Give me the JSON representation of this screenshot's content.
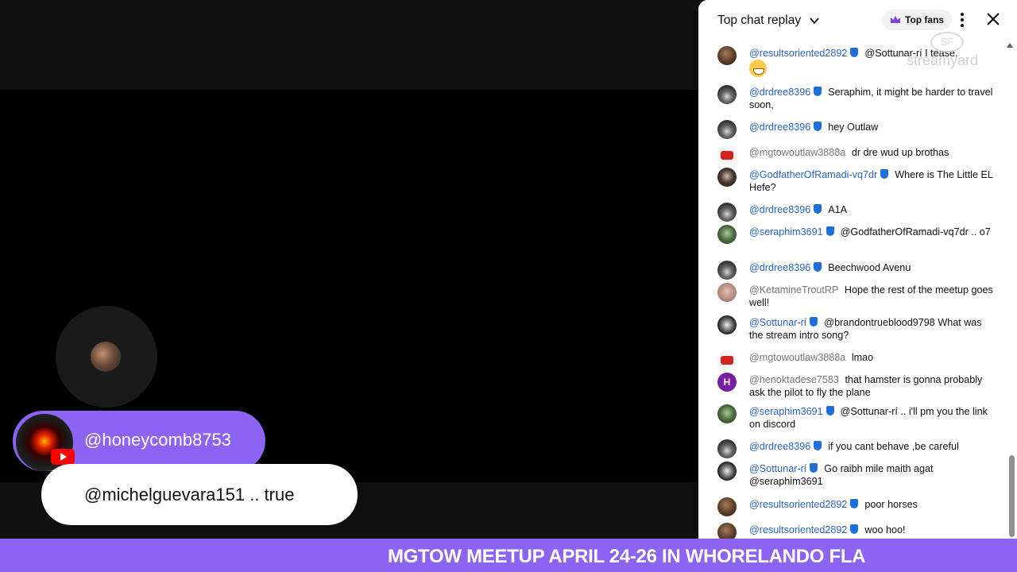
{
  "stream": {
    "guest_name": "@honeycomb8753",
    "guest_message": "@michelguevara151 .. true",
    "banner": "MGTOW MEETUP APRIL 24-26 IN WHORELANDO FLA"
  },
  "chat": {
    "title": "Top chat replay",
    "top_fans_label": "Top fans",
    "watermark": "streamyard",
    "messages": [
      {
        "author": "@resultsoriented2892",
        "text": "@Sottunar-rí I tease.",
        "mod": true,
        "avatar": "brown",
        "emoji": "grin"
      },
      {
        "author": "@drdree8396",
        "text": "Seraphim, it might be harder to travel soon,",
        "mod": true,
        "avatar": "car"
      },
      {
        "author": "@drdree8396",
        "text": "hey Outlaw",
        "mod": true,
        "avatar": "car"
      },
      {
        "author": "@mgtowoutlaw3888a",
        "text": "dr dre wud up brothas",
        "mod": false,
        "avatar": "yt"
      },
      {
        "author": "@GodfatherOfRamadi-vq7dr",
        "text": "Where is The Little EL Hefe?",
        "mod": true,
        "avatar": "dark"
      },
      {
        "author": "@drdree8396",
        "text": "A1A",
        "mod": true,
        "avatar": "car"
      },
      {
        "author": "@seraphim3691",
        "text": "@GodfatherOfRamadi-vq7dr .. o7",
        "mod": true,
        "avatar": "green"
      },
      {
        "author": "@drdree8396",
        "text": "Beechwood Avenu",
        "mod": true,
        "avatar": "car"
      },
      {
        "author": "@KetamineTroutRP",
        "text": "Hope the rest of the meetup goes well!",
        "mod": false,
        "avatar": "face"
      },
      {
        "author": "@Sottunar-rí",
        "text": "@brandontrueblood9798 What was the stream intro song?",
        "mod": true,
        "avatar": "skull"
      },
      {
        "author": "@mgtowoutlaw3888a",
        "text": "lmao",
        "mod": false,
        "avatar": "yt"
      },
      {
        "author": "@henoktadese7583",
        "text": "that hamster is gonna probably ask the pilot to fly the plane",
        "mod": false,
        "avatar": "purple",
        "initial": "H"
      },
      {
        "author": "@seraphim3691",
        "text": "@Sottunar-rí .. i'll pm you the link on discord",
        "mod": true,
        "avatar": "green"
      },
      {
        "author": "@drdree8396",
        "text": "if you cant behave ,be careful",
        "mod": true,
        "avatar": "car"
      },
      {
        "author": "@Sottunar-rí",
        "text": "Go raibh mile maith agat @seraphim3691",
        "mod": true,
        "avatar": "skull"
      },
      {
        "author": "@resultsoriented2892",
        "text": "poor horses",
        "mod": true,
        "avatar": "brown"
      },
      {
        "author": "@resultsoriented2892",
        "text": "woo hoo!",
        "mod": true,
        "avatar": "brown"
      }
    ]
  }
}
